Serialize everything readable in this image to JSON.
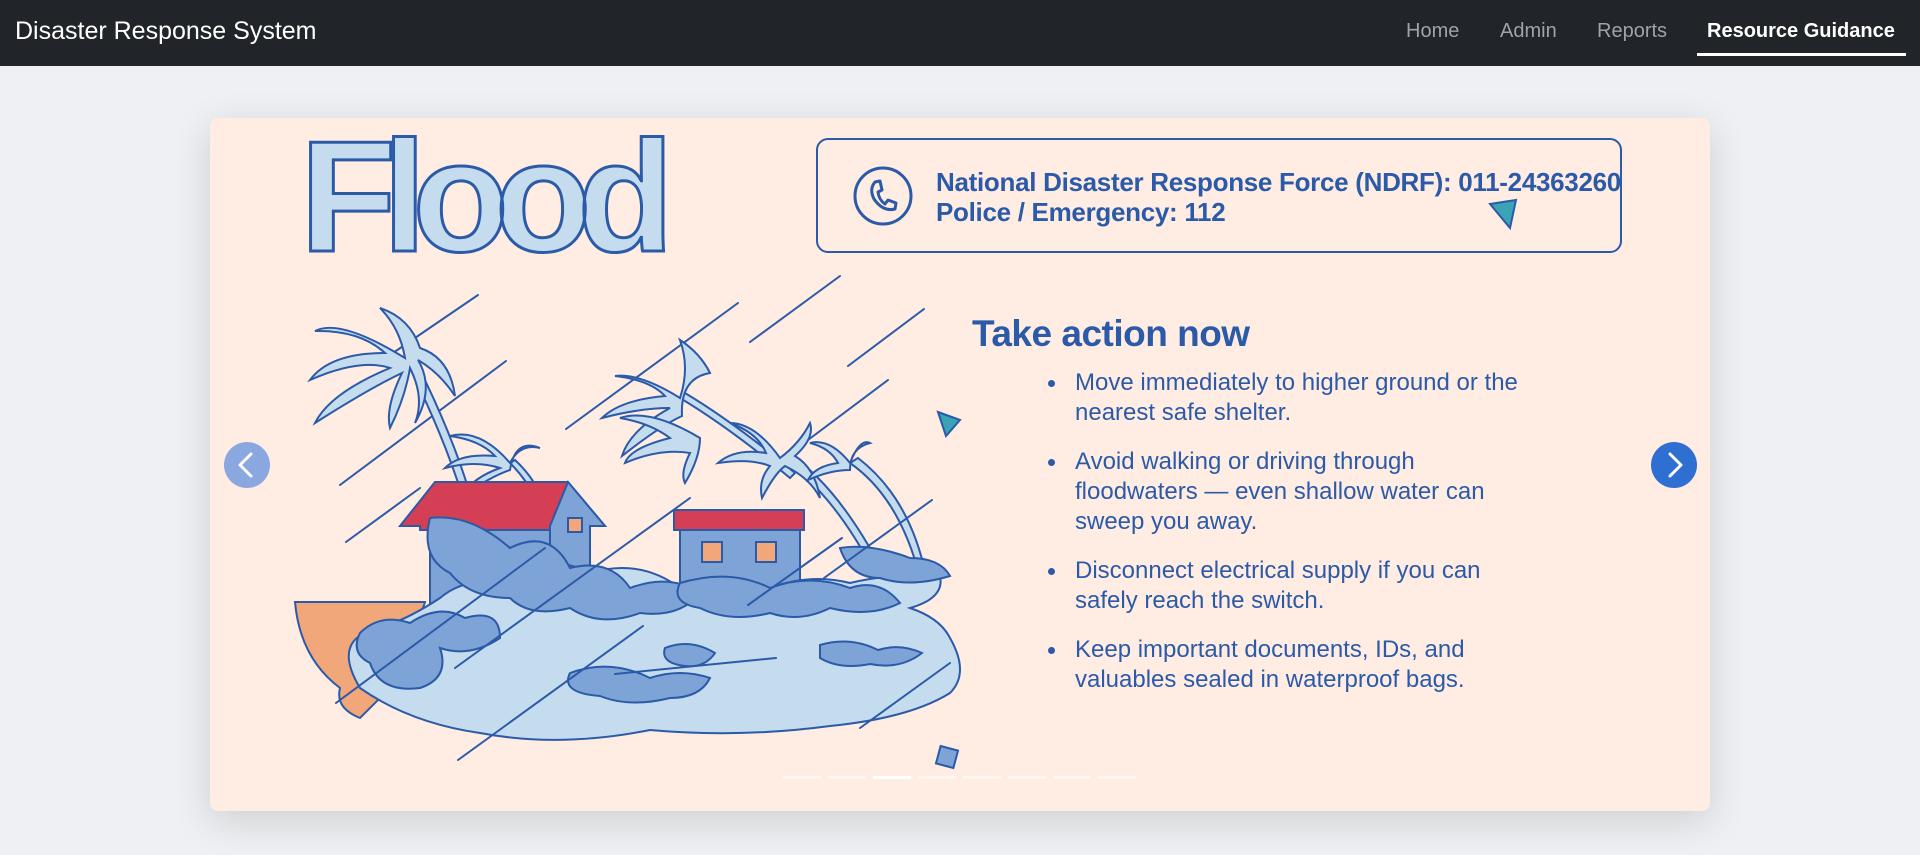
{
  "navbar": {
    "brand": "Disaster Response System",
    "links": [
      "Home",
      "Admin",
      "Reports",
      "Resource Guidance"
    ],
    "active": "Resource Guidance"
  },
  "slide": {
    "title": "Flood",
    "contacts": [
      "National Disaster Response Force (NDRF): 011-24363260",
      "Police / Emergency: 112"
    ],
    "action_title": "Take action now",
    "actions": [
      "Move immediately to higher ground or the nearest safe shelter.",
      "Avoid walking or driving through floodwaters — even shallow water can sweep you away.",
      "Disconnect electrical supply if you can safely reach the switch.",
      "Keep important documents, IDs, and valuables sealed in waterproof bags."
    ],
    "indicator_count": 8,
    "active_indicator": 3
  },
  "colors": {
    "navbar_bg": "#212529",
    "card_bg": "#ffece2",
    "accent_blue": "#2b5aa8",
    "roof_red": "#d43f55",
    "water_light": "#c5dcef",
    "water_mid": "#7ea3d6",
    "sand": "#f2a77a"
  },
  "icons": {
    "phone": "phone-icon",
    "prev": "chevron-left-icon",
    "next": "chevron-right-icon"
  }
}
